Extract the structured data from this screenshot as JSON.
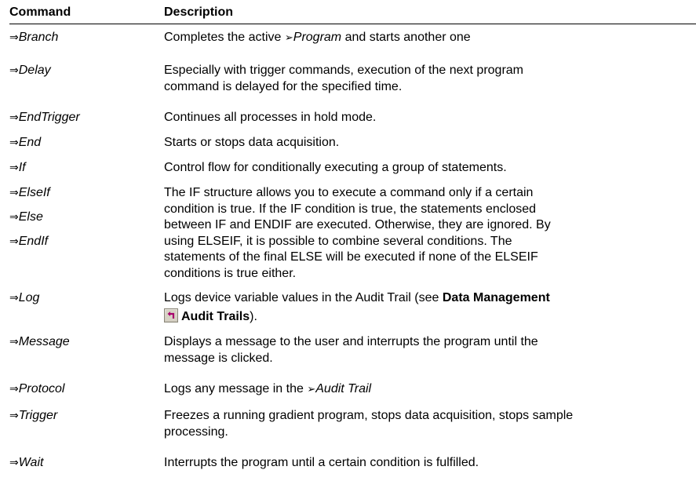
{
  "header": {
    "command": "Command",
    "description": "Description"
  },
  "glyphs": {
    "arrow": "⇒",
    "pointer": "➢"
  },
  "rows": [
    {
      "commands": [
        "Branch"
      ],
      "desc": {
        "before": "Completes the active ",
        "link": "Program",
        "after": " and starts another one"
      }
    },
    {
      "commands": [
        "Delay"
      ],
      "lines": [
        "Especially with trigger commands, execution of the next program",
        "command is delayed for the specified time."
      ]
    },
    {
      "commands": [
        "EndTrigger"
      ],
      "lines": [
        "Continues all processes in hold mode."
      ]
    },
    {
      "commands": [
        "End"
      ],
      "lines": [
        "Starts or stops data acquisition."
      ]
    },
    {
      "commands": [
        "If"
      ],
      "lines": [
        "Control flow for conditionally executing a group of statements."
      ]
    },
    {
      "commands": [
        "ElseIf",
        "Else",
        "EndIf"
      ],
      "lines": [
        "The IF structure allows you to execute a command only if a certain",
        "condition is true. If the IF condition is true, the statements enclosed",
        "between IF and ENDIF are executed. Otherwise, they are ignored. By",
        "using ELSEIF, it is possible to combine several conditions. The",
        "statements of the final ELSE will be executed if none of the ELSEIF",
        "conditions is true either."
      ]
    },
    {
      "commands": [
        "Log"
      ],
      "desc": {
        "text1": "Logs device variable values in the Audit Trail (see ",
        "bold1": "Data Management",
        "icon": "link-arrow-icon",
        "bold2": "Audit Trails",
        "text2": ")."
      }
    },
    {
      "commands": [
        "Message"
      ],
      "lines": [
        "Displays a message to the user and interrupts the program until the",
        "message is clicked."
      ]
    },
    {
      "commands": [
        "Protocol"
      ],
      "desc": {
        "before": "Logs any message in the ",
        "link": "Audit Trail",
        "after": ""
      }
    },
    {
      "commands": [
        "Trigger"
      ],
      "lines": [
        "Freezes a running gradient program, stops data acquisition, stops sample",
        "processing."
      ]
    },
    {
      "commands": [
        "Wait"
      ],
      "lines": [
        "Interrupts the program until a certain condition is fulfilled."
      ]
    }
  ]
}
